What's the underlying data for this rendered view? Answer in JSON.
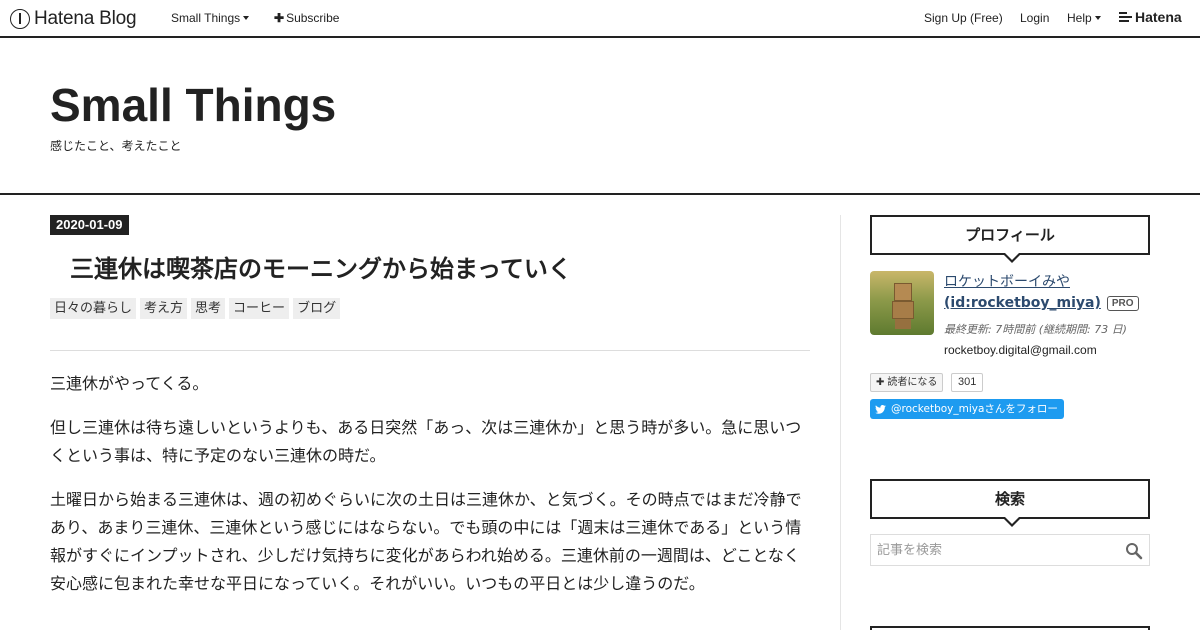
{
  "topbar": {
    "logo_text": "Hatena Blog",
    "blog_menu_label": "Small Things",
    "subscribe_label": "Subscribe",
    "signup_label": "Sign Up (Free)",
    "login_label": "Login",
    "help_label": "Help",
    "hatena_wordmark": "Hatena"
  },
  "header": {
    "title": "Small Things",
    "description": "感じたこと、考えたこと"
  },
  "entry": {
    "date": "2020-01-09",
    "title": "三連休は喫茶店のモーニングから始まっていく",
    "categories": [
      "日々の暮らし",
      "考え方",
      "思考",
      "コーヒー",
      "ブログ"
    ],
    "paragraphs": [
      "三連休がやってくる。",
      "但し三連休は待ち遠しいというよりも、ある日突然「あっ、次は三連休か」と思う時が多い。急に思いつくという事は、特に予定のない三連休の時だ。",
      "土曜日から始まる三連休は、週の初めぐらいに次の土日は三連休か、と気づく。その時点ではまだ冷静であり、あまり三連休、三連休という感じにはならない。でも頭の中には「週末は三連休である」という情報がすぐにインプットされ、少しだけ気持ちに変化があらわれ始める。三連休前の一週間は、どことなく安心感に包まれた幸せな平日になっていく。それがいい。いつもの平日とは少し違うのだ。"
    ]
  },
  "sidebar": {
    "profile": {
      "module_title": "プロフィール",
      "name": "ロケットボーイみや",
      "id": "(id:rocketboy_miya)",
      "badge": "PRO",
      "updated": "最終更新: 7時間前 (継続期間: 73 日)",
      "email": "rocketboy.digital@gmail.com",
      "reader_button": "読者になる",
      "reader_count": "301",
      "twitter_follow": "@rocketboy_miyaさんをフォロー"
    },
    "search": {
      "module_title": "検索",
      "placeholder": "記事を検索"
    }
  },
  "colors": {
    "text": "#222222",
    "link": "#2c4a6e",
    "twitter": "#1d9bf0",
    "category_bg": "#eeeeee"
  },
  "icons": [
    "hatena-blog-logo-icon",
    "caret-down-icon",
    "plus-icon",
    "hatena-logo-icon",
    "twitter-bird-icon",
    "search-icon"
  ]
}
